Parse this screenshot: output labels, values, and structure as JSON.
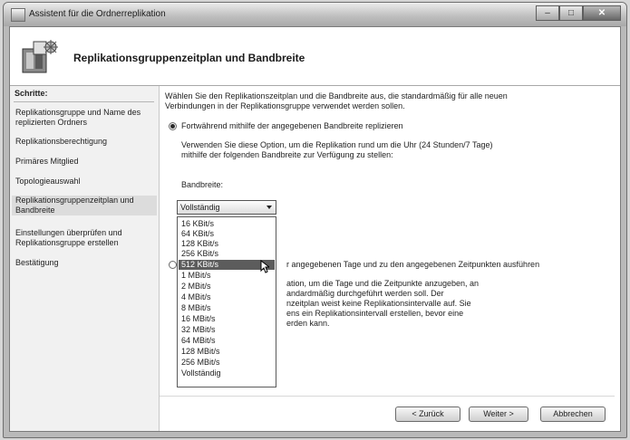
{
  "window": {
    "title": "Assistent für die Ordnerreplikation",
    "buttons": {
      "minimize": "–",
      "maximize": "□",
      "close": "✕"
    }
  },
  "header": {
    "title": "Replikationsgruppenzeitplan und Bandbreite",
    "icon": "wizard-icon"
  },
  "sidebar": {
    "heading": "Schritte:",
    "steps": [
      "Replikationsgruppe und Name des replizierten Ordners",
      "Replikationsberechtigung",
      "Primäres Mitglied",
      "Topologieauswahl",
      "Replikationsgruppenzeitplan und Bandbreite",
      "Einstellungen überprüfen und Replikationsgruppe erstellen",
      "Bestätigung"
    ],
    "active_index": 4
  },
  "main": {
    "intro": "Wählen Sie den Replikationszeitplan und die Bandbreite aus, die standardmäßig für alle neuen Verbindungen in der Replikationsgruppe verwendet werden sollen.",
    "option1_label": "Fortwährend mithilfe der angegebenen Bandbreite replizieren",
    "option1_desc": "Verwenden Sie diese Option, um die Replikation rund um die Uhr (24 Stunden/7 Tage) mithilfe der folgenden Bandbreite zur Verfügung zu stellen:",
    "bandwidth_label": "Bandbreite:",
    "bandwidth_value": "Vollständig",
    "option2_label_visible": "r angegebenen Tage und zu den angegebenen Zeitpunkten ausführen",
    "option2_desc_lines": [
      "ation, um die Tage und die Zeitpunkte anzugeben, an",
      "andardmäßig durchgeführt werden soll. Der",
      "nzeitplan weist keine Replikationsintervalle auf. Sie",
      "ens ein Replikationsintervall erstellen, bevor eine",
      "erden kann."
    ]
  },
  "dropdown": {
    "options": [
      "16 KBit/s",
      "64 KBit/s",
      "128 KBit/s",
      "256 KBit/s",
      "512 KBit/s",
      "1 MBit/s",
      "2 MBit/s",
      "4 MBit/s",
      "8 MBit/s",
      "16 MBit/s",
      "32 MBit/s",
      "64 MBit/s",
      "128 MBit/s",
      "256 MBit/s",
      "Vollständig"
    ],
    "selected_index": 4
  },
  "buttons": {
    "back": "< Zurück",
    "next": "Weiter >",
    "cancel": "Abbrechen"
  }
}
